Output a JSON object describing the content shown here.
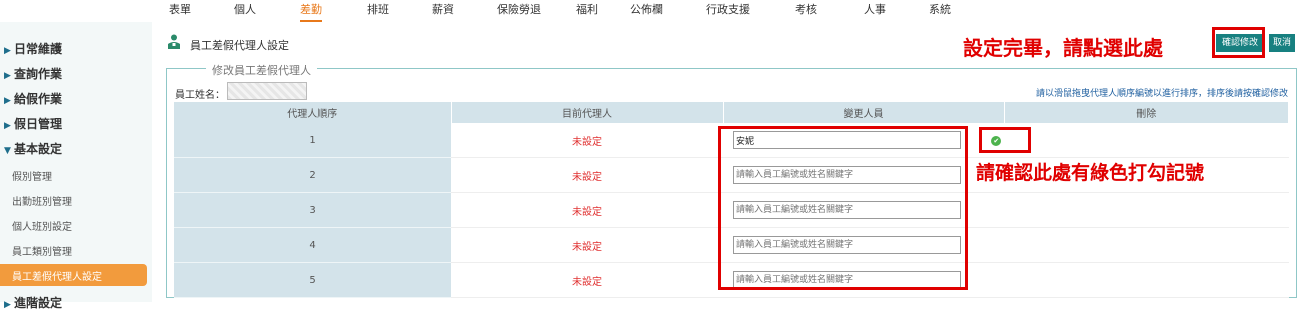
{
  "topnav": [
    {
      "label": "表單",
      "active": false
    },
    {
      "label": "個人",
      "active": false
    },
    {
      "label": "差勤",
      "active": true
    },
    {
      "label": "排班",
      "active": false
    },
    {
      "label": "薪資",
      "active": false
    },
    {
      "label": "保險勞退",
      "active": false
    },
    {
      "label": "福利",
      "active": false
    },
    {
      "label": "公佈欄",
      "active": false
    },
    {
      "label": "行政支援",
      "active": false
    },
    {
      "label": "考核",
      "active": false
    },
    {
      "label": "人事",
      "active": false
    },
    {
      "label": "系統",
      "active": false
    }
  ],
  "sidebar": {
    "sections": [
      {
        "label": "日常維護",
        "expanded": false
      },
      {
        "label": "查詢作業",
        "expanded": false
      },
      {
        "label": "給假作業",
        "expanded": false
      },
      {
        "label": "假日管理",
        "expanded": false
      },
      {
        "label": "基本設定",
        "expanded": true
      }
    ],
    "subitems": [
      "假別管理",
      "出勤班別管理",
      "個人班別設定",
      "員工類別管理"
    ],
    "active_item": "員工差假代理人設定",
    "next_section": "進階設定"
  },
  "page": {
    "title": "員工差假代理人設定",
    "confirm_label": "確認修改",
    "cancel_label": "取消",
    "annotation_top": "設定完畢，請點選此處",
    "annotation_mid": "請確認此處有綠色打勾記號"
  },
  "form": {
    "legend": "修改員工差假代理人",
    "employee_label": "員工姓名：",
    "hint": "請以滑鼠拖曳代理人順序編號以進行排序，排序後請按確認修改",
    "columns": [
      "代理人順序",
      "目前代理人",
      "變更人員",
      "刪除"
    ],
    "placeholder": "請輸入員工編號或姓名關鍵字",
    "rows": [
      {
        "order": "1",
        "current": "未設定",
        "value": "安妮",
        "checked": true
      },
      {
        "order": "2",
        "current": "未設定",
        "value": "",
        "checked": false
      },
      {
        "order": "3",
        "current": "未設定",
        "value": "",
        "checked": false
      },
      {
        "order": "4",
        "current": "未設定",
        "value": "",
        "checked": false
      },
      {
        "order": "5",
        "current": "未設定",
        "value": "",
        "checked": false
      }
    ]
  },
  "colors": {
    "accent": "#e8791b",
    "teal": "#178080",
    "annotation_red": "#e00000",
    "status_red": "#e03030",
    "check_green": "#4db34d"
  }
}
